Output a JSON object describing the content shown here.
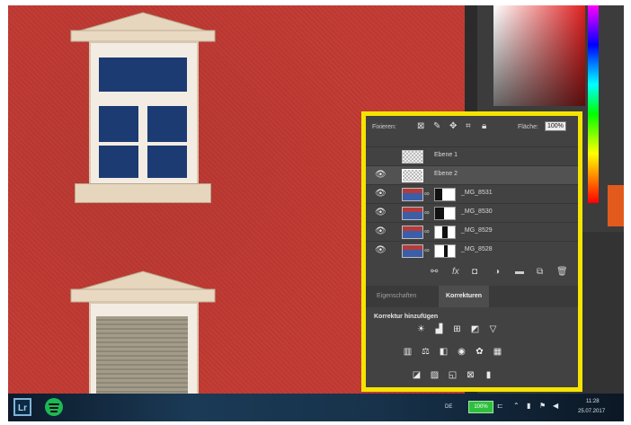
{
  "taskbar": {
    "apps": [
      {
        "name": "lightroom-icon",
        "label": "Lr"
      },
      {
        "name": "spotify-icon",
        "label": ""
      }
    ],
    "language": "DE",
    "battery": "100%",
    "time": "11:28",
    "date": "25.07.2017"
  },
  "layers_panel": {
    "lock_label": "Fixieren:",
    "fill_label": "Fläche:",
    "fill_value": "100%",
    "layers": [
      {
        "name": "Ebene 1",
        "visible": false,
        "selected": false
      },
      {
        "name": "Ebene 2",
        "visible": true,
        "selected": true
      },
      {
        "name": "_MG_8531",
        "visible": true,
        "selected": false
      },
      {
        "name": "_MG_8530",
        "visible": true,
        "selected": false
      },
      {
        "name": "_MG_8529",
        "visible": true,
        "selected": false
      },
      {
        "name": "_MG_8528",
        "visible": true,
        "selected": false
      }
    ],
    "footer_icons": [
      "link-icon",
      "fx-icon",
      "mask-icon",
      "adjustment-icon",
      "folder-icon",
      "new-layer-icon",
      "trash-icon"
    ]
  },
  "adjustments_panel": {
    "tabs": [
      {
        "label": "Eigenschaften",
        "active": false
      },
      {
        "label": "Korrekturen",
        "active": true
      }
    ],
    "title": "Korrektur hinzufügen",
    "rows": [
      [
        "brightness-icon",
        "levels-icon",
        "curves-icon",
        "exposure-icon",
        "vibrance-icon"
      ],
      [
        "hue-saturation-icon",
        "color-balance-icon",
        "black-white-icon",
        "photo-filter-icon",
        "channel-mixer-icon",
        "color-lookup-icon"
      ],
      [
        "invert-icon",
        "posterize-icon",
        "threshold-icon",
        "selective-color-icon",
        "gradient-map-icon"
      ]
    ]
  },
  "colors": {
    "highlight_border": "#f5e400",
    "facade": "#c23a33",
    "panel_bg": "#424242",
    "orange_tab": "#e35b1c"
  }
}
